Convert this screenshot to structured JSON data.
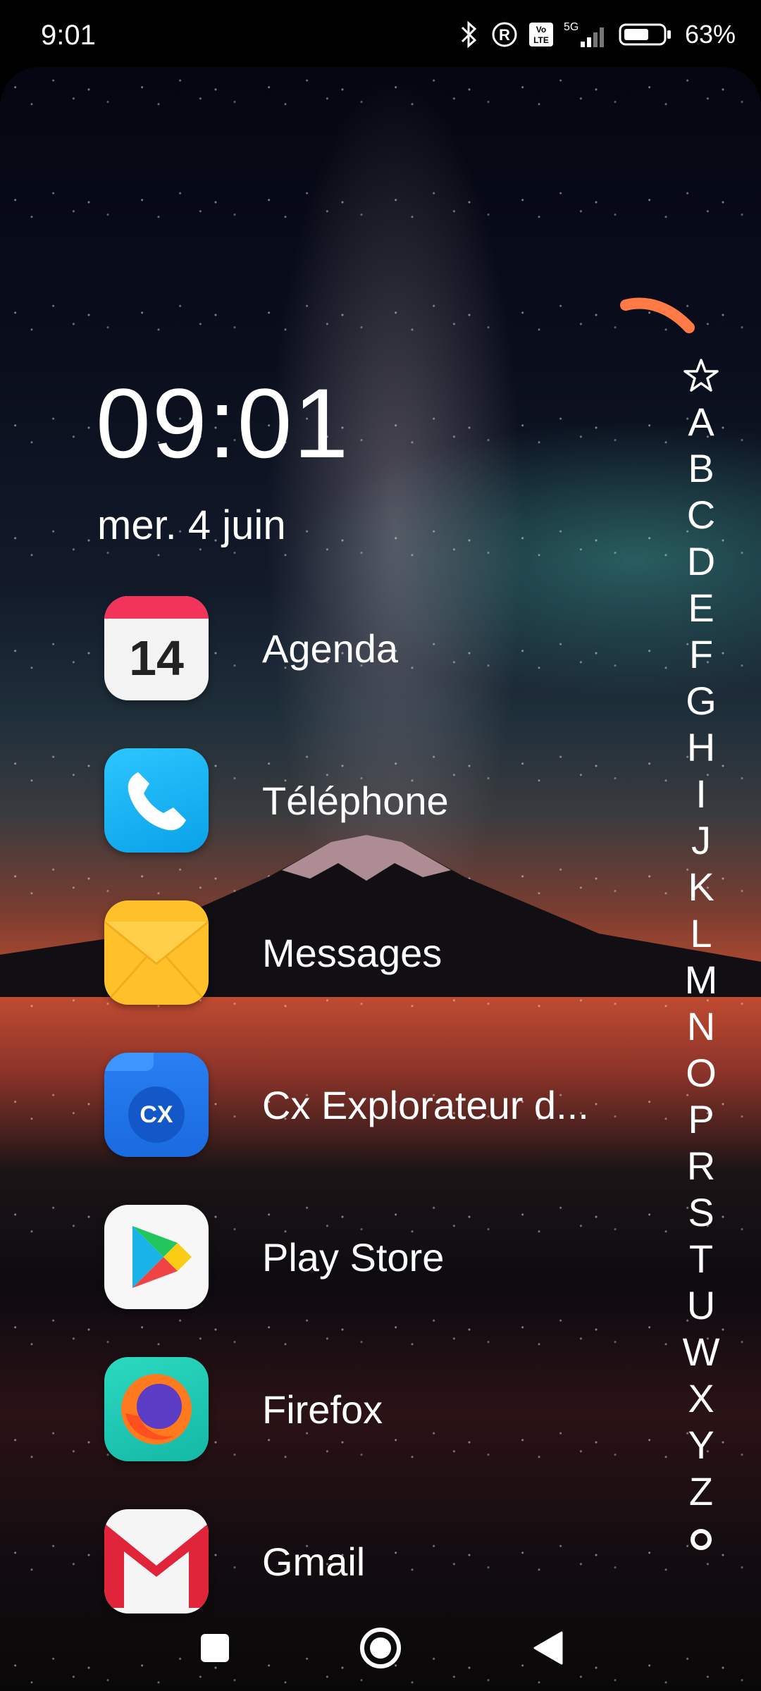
{
  "status_bar": {
    "time": "9:01",
    "network": "5G",
    "volte": "Vo LTE",
    "battery_percent": "63%"
  },
  "home": {
    "clock": "09:01",
    "date": "mer. 4 juin",
    "calendar_day": "14",
    "files_badge": "CX"
  },
  "apps": [
    {
      "label": "Agenda",
      "icon": "calendar-icon"
    },
    {
      "label": "Téléphone",
      "icon": "phone-icon"
    },
    {
      "label": "Messages",
      "icon": "messages-icon"
    },
    {
      "label": "Cx Explorateur d...",
      "icon": "folder-icon"
    },
    {
      "label": "Play Store",
      "icon": "play-store-icon"
    },
    {
      "label": "Firefox",
      "icon": "firefox-icon"
    },
    {
      "label": "Gmail",
      "icon": "gmail-icon"
    }
  ],
  "alphabet_index": [
    "A",
    "B",
    "C",
    "D",
    "E",
    "F",
    "G",
    "H",
    "I",
    "J",
    "K",
    "L",
    "M",
    "N",
    "O",
    "P",
    "R",
    "S",
    "T",
    "U",
    "W",
    "X",
    "Y",
    "Z"
  ],
  "colors": {
    "accent_arc": "#ff7a45",
    "calendar_red": "#f2345a",
    "phone_blue": "#1ab6f5",
    "messages_yellow": "#ffc12a",
    "files_blue": "#1e78f0",
    "firefox_teal": "#20c9b3"
  }
}
